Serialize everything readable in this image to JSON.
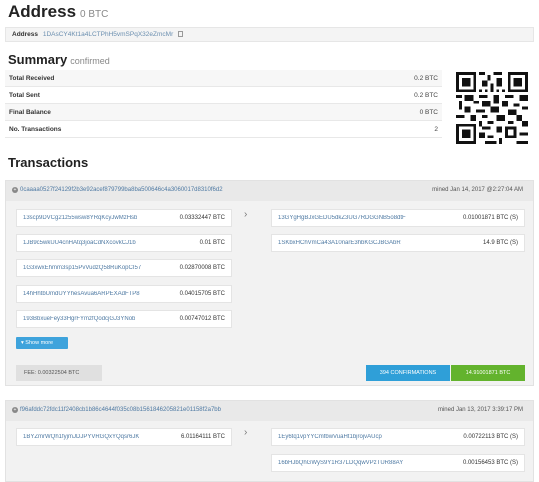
{
  "address_header": {
    "title": "Address",
    "balance": "0 BTC"
  },
  "address_bar": {
    "label": "Address",
    "value": "1DAsCY4Kt1a4LCTPhH5vmSPqX32eZmcMr"
  },
  "summary": {
    "title": "Summary",
    "subtitle": "confirmed",
    "rows": [
      {
        "label": "Total Received",
        "value": "0.2 BTC"
      },
      {
        "label": "Total Sent",
        "value": "0.2 BTC"
      },
      {
        "label": "Final Balance",
        "value": "0 BTC"
      },
      {
        "label": "No. Transactions",
        "value": "2"
      }
    ]
  },
  "transactions_title": "Transactions",
  "tx1": {
    "hash": "0caaaa0527f24129f2b3e92acef879799ba8ba500646c4a3060017d8310f6d2",
    "mined": "mined Jan 14, 2017 @2:27:04 AM",
    "inputs": [
      {
        "address": "13scp9DVCg21z55wsw8YRqKcyJwMzHsb",
        "amount": "0.03332447 BTC"
      },
      {
        "address": "1JB9c5wkUU4cnHAtq3joaCdNXcovkCJ1b",
        "amount": "0.01 BTC"
      },
      {
        "address": "1G3xwxEhmm3sp15PvVudzQ58RuKopCI57",
        "amount": "0.02870008 BTC"
      },
      {
        "address": "14hHhtbUmdUYYhesAvua6ARPEXAdFTP8",
        "amount": "0.04015705 BTC"
      },
      {
        "address": "193BbxueFey33HgrFYmzfQodcjGJ3YNob",
        "amount": "0.00747012 BTC"
      }
    ],
    "outputs": [
      {
        "address": "13GYgHgBJxGEDU5dkZ3UG7RDGGNB5o8dtF",
        "amount": "0.01001871 BTC (S)"
      },
      {
        "address": "1SKbxHChVmCa43A10narE3hbKGCJBGAbR",
        "amount": "14.9 BTC (S)"
      }
    ],
    "show_more": "Show more",
    "fee": "FEE: 0.00322504 BTC",
    "confirmations": "394 CONFIRMATIONS",
    "total": "14.91001871 BTC"
  },
  "tx2": {
    "hash": "f96afddc72fdc11f2408cb1b86c4644f035c08b1561846205821e01158f2a7bb",
    "mined": "mined Jan 13, 2017 3:39:17 PM",
    "inputs": [
      {
        "address": "1BYZmrWQh1fyjmJDJPYVRGQxYQqsr6JK",
        "amount": "6.01164111 BTC"
      }
    ],
    "outputs": [
      {
        "address": "1Ey6tq1vpYYCmfbwVuaHt1bjrojvAUcp",
        "amount": "0.00722113 BTC (S)"
      },
      {
        "address": "16bHJbQhGWyS9Y1R37LDQqwVPzTUR88AY",
        "amount": "0.00156453 BTC (S)"
      }
    ]
  }
}
